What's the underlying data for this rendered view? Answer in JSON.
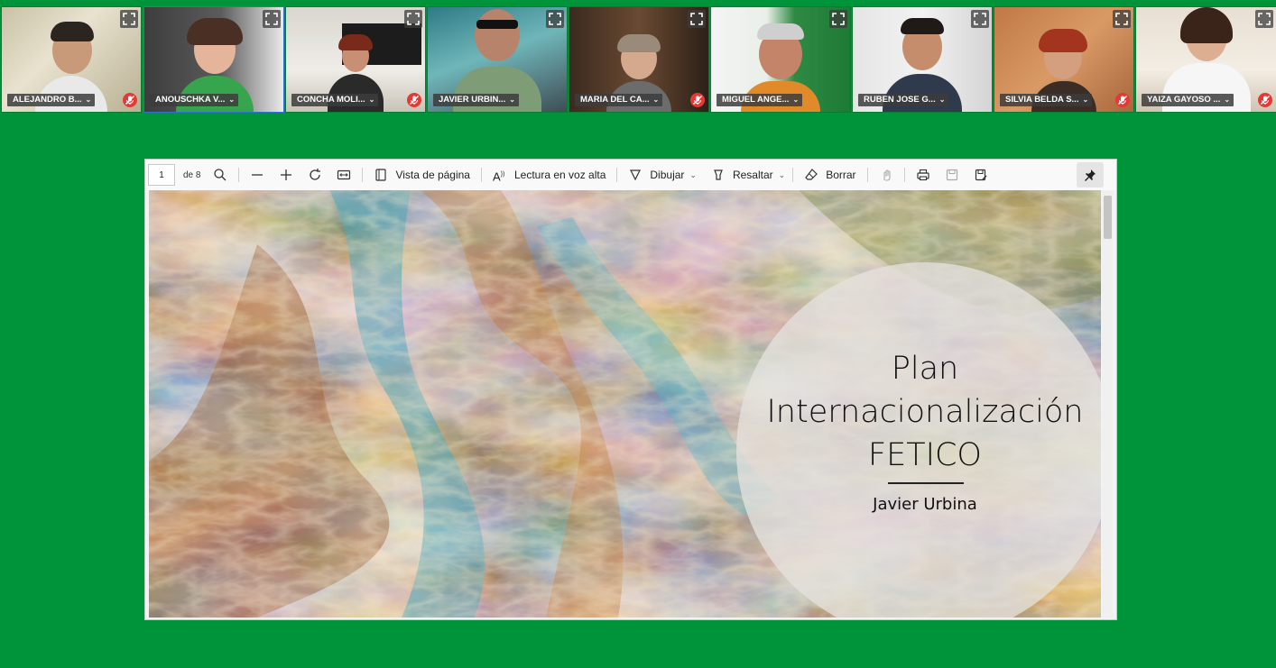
{
  "participants": [
    {
      "name": "ALEJANDRO B...",
      "muted": true
    },
    {
      "name": "ANOUSCHKA V...",
      "muted": false,
      "active": true
    },
    {
      "name": "CONCHA MOLI...",
      "muted": true
    },
    {
      "name": "JAVIER URBIN...",
      "muted": false
    },
    {
      "name": "MARIA DEL CA...",
      "muted": true
    },
    {
      "name": "MIGUEL ANGE...",
      "muted": false
    },
    {
      "name": "RUBEN JOSE G...",
      "muted": false
    },
    {
      "name": "SILVIA BELDA S...",
      "muted": true
    },
    {
      "name": "YAIZA GAYOSO ...",
      "muted": true
    }
  ],
  "toolbar": {
    "page_current": "1",
    "page_total": "de 8",
    "page_view": "Vista de página",
    "read_aloud": "Lectura en voz alta",
    "draw": "Dibujar",
    "highlight": "Resaltar",
    "erase": "Borrar"
  },
  "slide": {
    "title": "Plan\nInternacionalización\nFETICO",
    "author": "Javier Urbina"
  },
  "colors": {
    "background": "#00943a",
    "active_tile": "#2f6fd6",
    "muted_badge": "#e53935"
  }
}
